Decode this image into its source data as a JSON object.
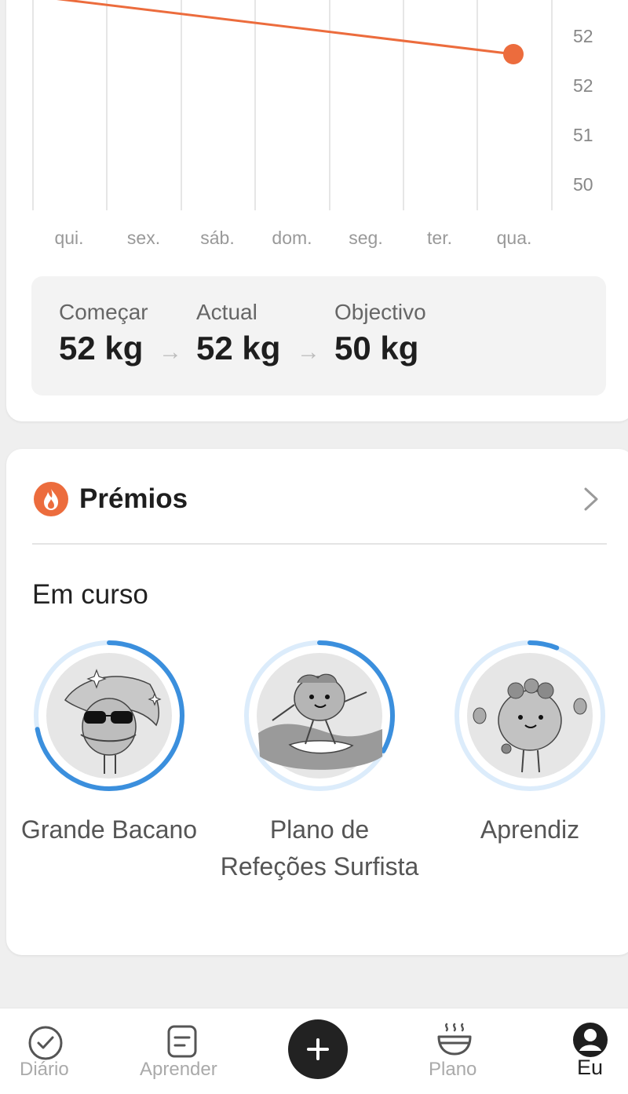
{
  "weight_chart": {
    "y_ticks": [
      "52",
      "52",
      "51",
      "50"
    ],
    "x_ticks": [
      "qui.",
      "sex.",
      "sáb.",
      "dom.",
      "seg.",
      "ter.",
      "qua."
    ],
    "line_color": "#ec6c3d"
  },
  "stats": {
    "start_label": "Começar",
    "start_value": "52 kg",
    "current_label": "Actual",
    "current_value": "52 kg",
    "goal_label": "Objectivo",
    "goal_value": "50 kg",
    "arrow": "→"
  },
  "awards": {
    "title": "Prémios",
    "section_title": "Em curso",
    "accent_color": "#3b8fdd",
    "items": [
      {
        "name": "Grande Bacano",
        "progress": 0.72
      },
      {
        "name": "Plano de Refeções Surfista",
        "progress": 0.33
      },
      {
        "name": "Aprendiz",
        "progress": 0.06
      }
    ]
  },
  "nav": {
    "diary": "Diário",
    "learn": "Aprender",
    "plan": "Plano",
    "me": "Eu"
  }
}
